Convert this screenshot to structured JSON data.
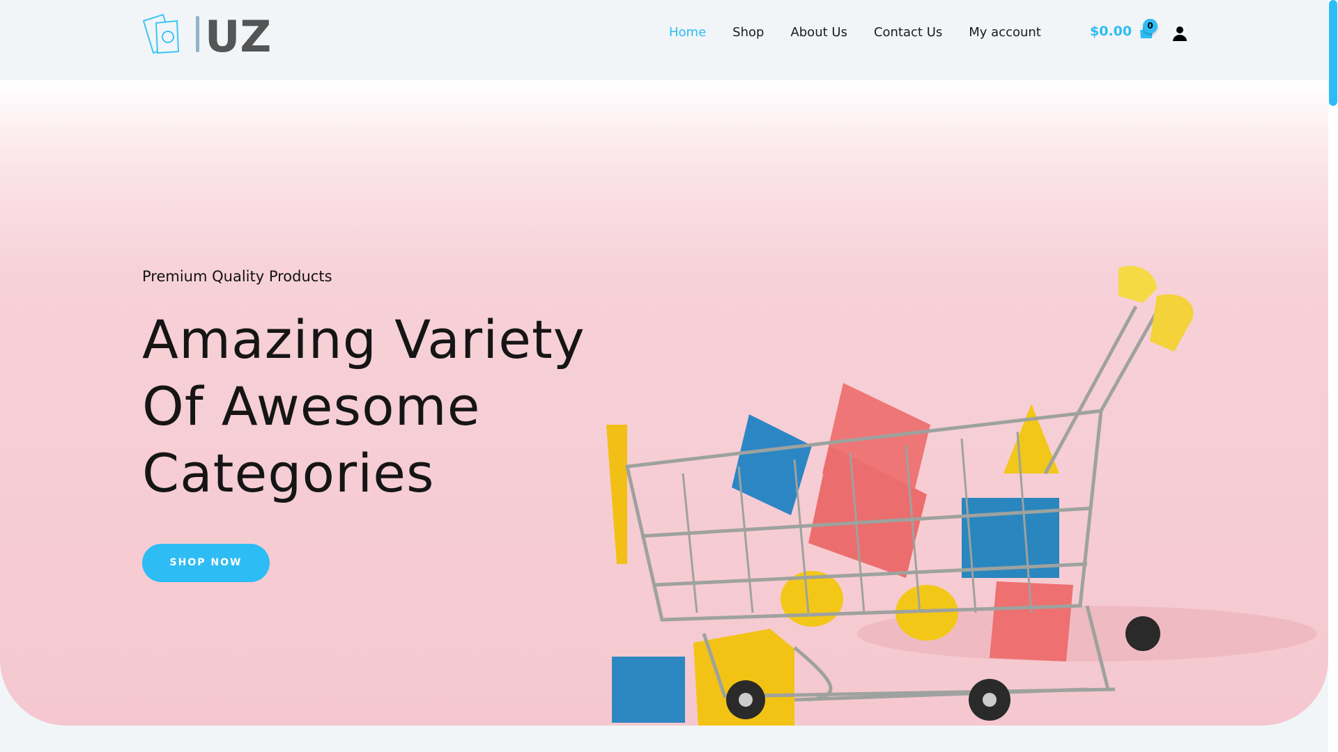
{
  "brand": {
    "logo_text": "UZ",
    "accent": "#2ebcf5"
  },
  "nav": {
    "items": [
      {
        "label": "Home",
        "active": true
      },
      {
        "label": "Shop"
      },
      {
        "label": "About Us"
      },
      {
        "label": "Contact Us"
      },
      {
        "label": "My account"
      }
    ]
  },
  "cart": {
    "total": "$0.00",
    "count": "0"
  },
  "hero": {
    "subtitle": "Premium Quality Products",
    "title_lines": [
      "Amazing Variety",
      "Of Awesome",
      "Categories"
    ],
    "cta": "SHOP NOW"
  }
}
